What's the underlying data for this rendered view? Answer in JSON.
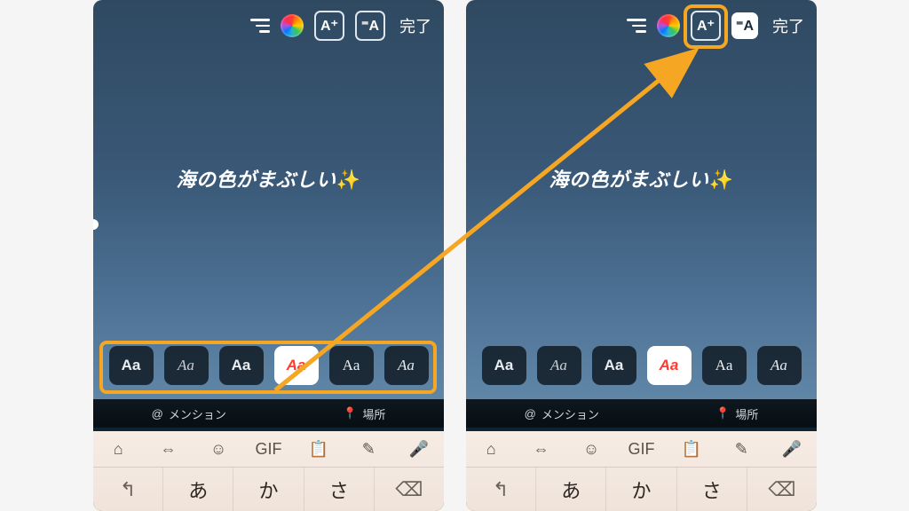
{
  "header": {
    "done_label": "完了",
    "effects_icon_text": "A⁺",
    "align_icon_text": "⁼A"
  },
  "caption": {
    "text": "海の色がまぶしい",
    "emoji": "✨"
  },
  "fonts": {
    "options": [
      {
        "label": "Aa"
      },
      {
        "label": "Aa"
      },
      {
        "label": "Aa"
      },
      {
        "label": "Aa"
      },
      {
        "label": "Aa"
      },
      {
        "label": "Aa"
      }
    ],
    "selected_index": 3
  },
  "tagbar": {
    "mention": {
      "icon": "@",
      "label": "メンション"
    },
    "location": {
      "icon": "📍",
      "label": "場所"
    }
  },
  "keyboard": {
    "tools": [
      "⌂",
      "⇔",
      "☺",
      "GIF",
      "📋",
      "✎",
      "🎤"
    ],
    "keys": [
      "↰",
      "あ",
      "か",
      "さ",
      "⌫"
    ]
  }
}
